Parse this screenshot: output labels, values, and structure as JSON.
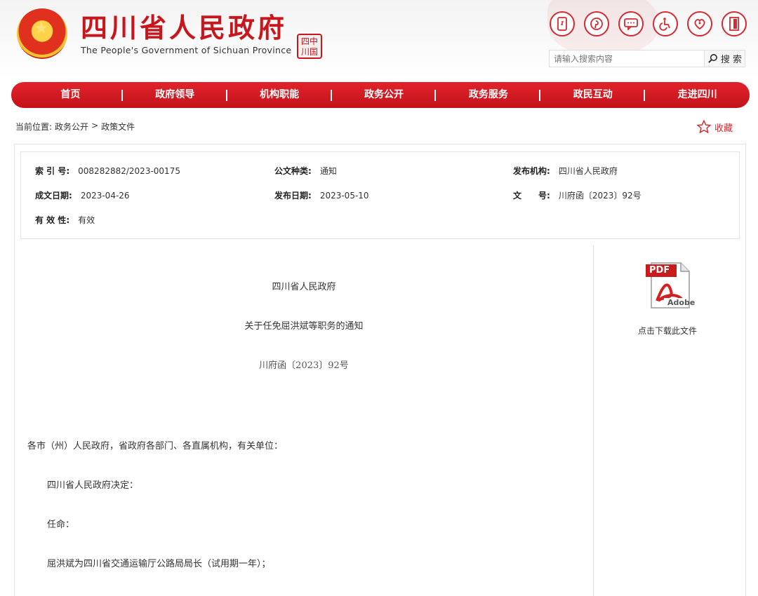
{
  "header": {
    "title": "四川省人民政府",
    "subtitle": "The People's Government of Sichuan Province",
    "seal_text": "四中\n川国",
    "colors": {
      "brand_red": "#c8161d",
      "nav_red": "#d7282f"
    },
    "util_icons": [
      "mobile-icon",
      "pinterest-like-icon",
      "message-icon",
      "accessibility-icon",
      "elderly-care-icon",
      "exit-door-icon"
    ]
  },
  "search": {
    "placeholder": "请输入搜索内容",
    "button_label": "搜 索"
  },
  "nav": {
    "items": [
      "首页",
      "政府领导",
      "机构职能",
      "政务公开",
      "政务服务",
      "政民互动",
      "走进四川"
    ]
  },
  "breadcrumb": {
    "prefix": "当前位置:",
    "items": [
      "政务公开",
      ">",
      "政策文件"
    ]
  },
  "favorite": {
    "label": "收藏"
  },
  "meta": {
    "index_label": "索 引 号:",
    "index_value": "008282882/2023-00175",
    "doc_type_label": "公文种类:",
    "doc_type_value": "通知",
    "issuer_label": "发布机构:",
    "issuer_value": "四川省人民政府",
    "created_label": "成文日期:",
    "created_value": "2023-04-26",
    "published_label": "发布日期:",
    "published_value": "2023-05-10",
    "docnum_label": "文　　号:",
    "docnum_value": "川府函〔2023〕92号",
    "validity_label": "有 效 性:",
    "validity_value": "有效"
  },
  "document": {
    "issuer": "四川省人民政府",
    "title": "关于任免屈洪斌等职务的通知",
    "number": "川府函〔2023〕92号",
    "salutation": "各市（州）人民政府，省政府各部门、各直属机构，有关单位：",
    "p1": "四川省人民政府决定：",
    "p2": "任命：",
    "p3": "屈洪斌为四川省交通运输厅公路局局长（试用期一年）；"
  },
  "download": {
    "pdf_text": "PDF",
    "adobe_text": "Adobe",
    "label": "点击下载此文件"
  }
}
